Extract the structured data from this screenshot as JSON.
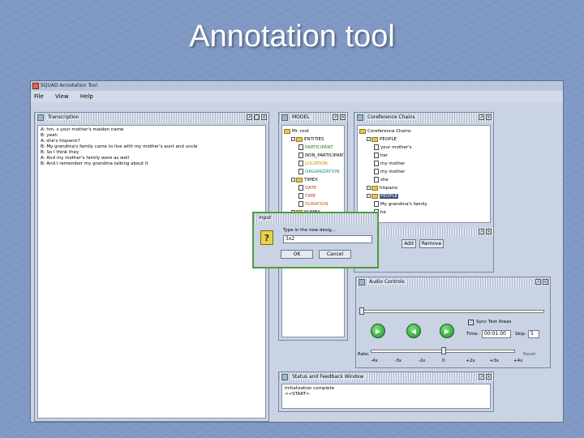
{
  "slide": {
    "title": "Annotation tool"
  },
  "app": {
    "title": "SQUAD Annotation Tool",
    "menu": [
      "File",
      "View",
      "Help"
    ]
  },
  "transcription": {
    "title": "Transcription",
    "lines": [
      "A: hm. s your mother's maiden name",
      "B: yeah",
      "A: she's hispanic?",
      "B: My grandma's family came to live with my mother's aunt and uncle",
      "B: So I think they",
      "A: And my mother's family were as well",
      "B: And I remember my grandma talking about it"
    ]
  },
  "model": {
    "title": "MODEL",
    "root": "Mr. root",
    "items": [
      {
        "label": "ENTITIES",
        "kind": "folder",
        "level": 1,
        "color": "#000000"
      },
      {
        "label": "PARTICIPANT",
        "kind": "doc",
        "level": 2,
        "color": "#2a7a1f"
      },
      {
        "label": "NON_PARTICIPANT",
        "kind": "doc",
        "level": 2,
        "color": "#000000"
      },
      {
        "label": "LOCATION",
        "kind": "doc",
        "level": 2,
        "color": "#c28d00"
      },
      {
        "label": "ORGANIZATION",
        "kind": "doc",
        "level": 2,
        "color": "#1a8a8a"
      },
      {
        "label": "TIMEX",
        "kind": "folder",
        "level": 1,
        "color": "#000000"
      },
      {
        "label": "DATE",
        "kind": "doc",
        "level": 2,
        "color": "#c04020"
      },
      {
        "label": "TIME",
        "kind": "doc",
        "level": 2,
        "color": "#c04020"
      },
      {
        "label": "DURATION",
        "kind": "doc",
        "level": 2,
        "color": "#c06010"
      },
      {
        "label": "NUMEX",
        "kind": "folder",
        "level": 1,
        "color": "#000000"
      }
    ]
  },
  "coref": {
    "title": "Coreference Chains",
    "root": "Coreference Chains",
    "items": [
      {
        "label": "PEOPLE",
        "kind": "folder",
        "level": 1
      },
      {
        "label": "your mother's",
        "kind": "doc",
        "level": 2
      },
      {
        "label": "her",
        "kind": "doc",
        "level": 2
      },
      {
        "label": "my mother",
        "kind": "doc",
        "level": 2
      },
      {
        "label": "my mother",
        "kind": "doc",
        "level": 2
      },
      {
        "label": "she",
        "kind": "doc",
        "level": 2
      },
      {
        "label": "hispanic",
        "kind": "folder",
        "level": 1
      },
      {
        "label": "PEOPLE",
        "kind": "folder",
        "level": 1,
        "selected": true
      },
      {
        "label": "My grandma's family",
        "kind": "doc",
        "level": 2
      },
      {
        "label": "he",
        "kind": "doc",
        "level": 2
      }
    ],
    "add_label": "Add",
    "remove_label": "Remove"
  },
  "dialog": {
    "title": "Input",
    "message": "Type in the new desig...",
    "value": "3x2",
    "ok_label": "OK",
    "cancel_label": "Cancel",
    "icon": "question-icon"
  },
  "audio": {
    "title": "Audio Controls",
    "sync_label": "Sync Text Areas",
    "time_label": "Time:",
    "time_value": "00:01.00",
    "skip_label": "Skip:",
    "skip_value": "5",
    "rate_label": "Rate:",
    "reset_label": "Reset",
    "rate_ticks": [
      "-4x",
      "-3x",
      "-2x",
      "0",
      "+2x",
      "+3x",
      "+4x"
    ]
  },
  "status": {
    "title": "Status and Feedback Window",
    "lines": [
      "Initialization complete",
      "<<START>"
    ]
  }
}
